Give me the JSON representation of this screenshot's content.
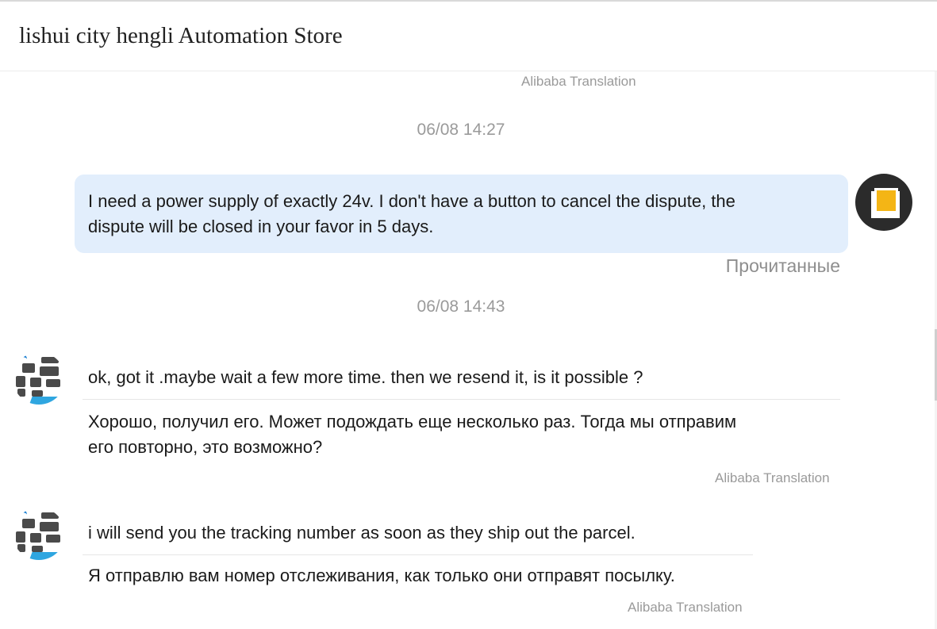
{
  "header": {
    "title": "lishui city hengli Automation Store"
  },
  "messages": {
    "top_translation_tag": "Alibaba Translation",
    "timestamp_1": "06/08 14:27",
    "outgoing": {
      "text_line_1": "I need a power supply of exactly 24v. I don't have a button to cancel the dispute, the",
      "text_line_2": "dispute will be closed in your favor in 5 days.",
      "read_status": "Прочитанные"
    },
    "timestamp_2": "06/08 14:43",
    "incoming_1": {
      "original": "ok, got it .maybe wait a few more time. then we resend it, is it possible ?",
      "translation_line_1": "Хорошо, получил его. Может подождать еще несколько раз. Тогда мы отправим",
      "translation_line_2": "его повторно, это возможно?",
      "translation_tag": "Alibaba Translation"
    },
    "incoming_2": {
      "original": "i will send you the tracking number as soon as they ship out the parcel.",
      "translation": "Я отправлю вам номер отслеживания, как только они отправят посылку.",
      "translation_tag": "Alibaba Translation"
    }
  },
  "colors": {
    "outgoing_bubble": "#e2eefc",
    "muted_text": "#9a9a9a",
    "avatar_accent": "#f4b515"
  }
}
